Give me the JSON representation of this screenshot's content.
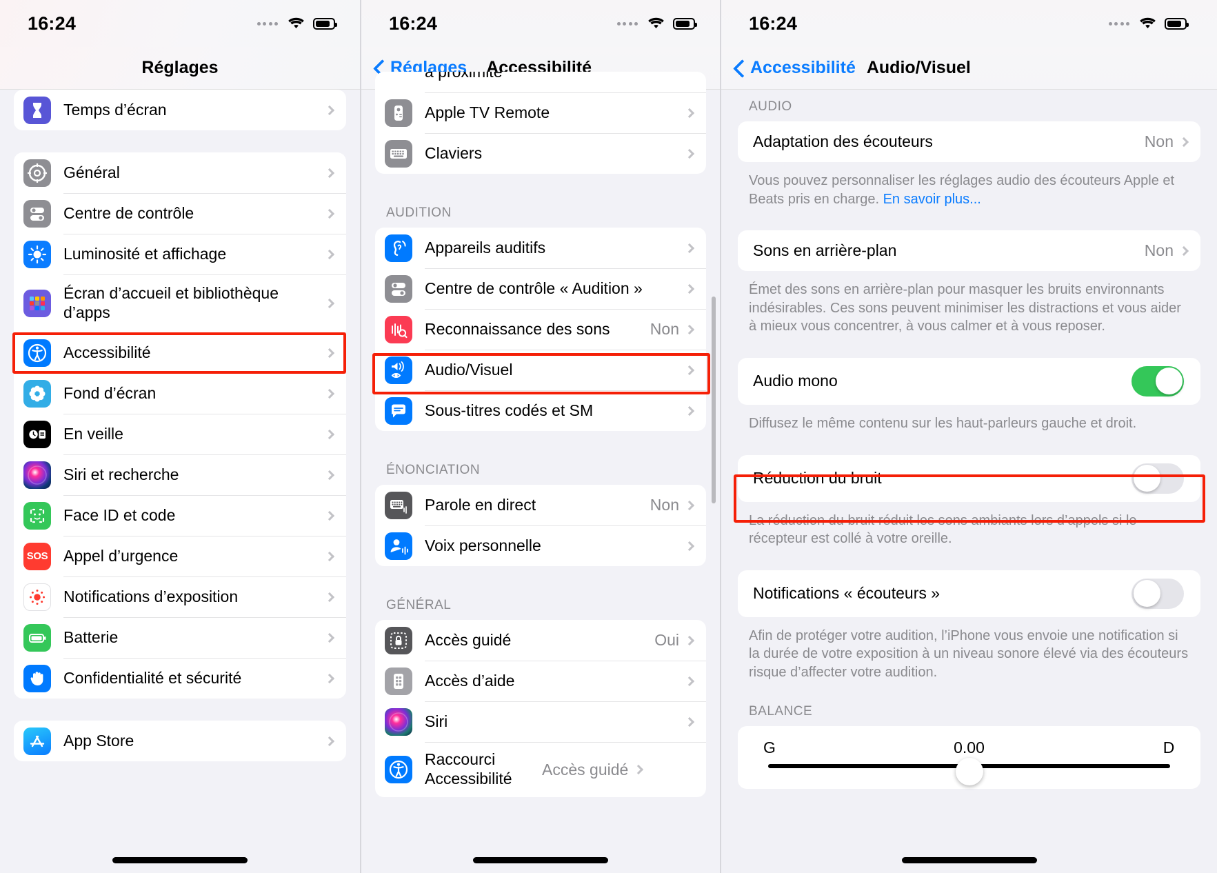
{
  "panels": [
    {
      "status": {
        "time": "16:24"
      },
      "nav": {
        "title": "Réglages"
      },
      "groups": [
        {
          "rows": [
            {
              "label": "Temps d’écran",
              "icon": "hourglass-icon",
              "chevron": true
            }
          ]
        },
        {
          "rows": [
            {
              "label": "Général",
              "icon": "gear-icon",
              "chevron": true
            },
            {
              "label": "Centre de contrôle",
              "icon": "control-center-icon",
              "chevron": true
            },
            {
              "label": "Luminosité et affichage",
              "icon": "brightness-icon",
              "chevron": true
            },
            {
              "label": "Écran d’accueil et bibliothèque d’apps",
              "icon": "home-screen-icon",
              "chevron": true
            },
            {
              "label": "Accessibilité",
              "icon": "accessibility-icon",
              "chevron": true,
              "highlight": true
            },
            {
              "label": "Fond d’écran",
              "icon": "wallpaper-icon",
              "chevron": true
            },
            {
              "label": "En veille",
              "icon": "standby-icon",
              "chevron": true
            },
            {
              "label": "Siri et recherche",
              "icon": "siri-icon",
              "chevron": true
            },
            {
              "label": "Face ID et code",
              "icon": "face-id-icon",
              "chevron": true
            },
            {
              "label": "Appel d’urgence",
              "icon": "sos-icon",
              "chevron": true
            },
            {
              "label": "Notifications d’exposition",
              "icon": "exposure-notification-icon",
              "chevron": true
            },
            {
              "label": "Batterie",
              "icon": "battery-icon",
              "chevron": true
            },
            {
              "label": "Confidentialité et sécurité",
              "icon": "privacy-hand-icon",
              "chevron": true
            }
          ]
        },
        {
          "rows": [
            {
              "label": "App Store",
              "icon": "app-store-icon",
              "chevron": true
            }
          ]
        }
      ]
    },
    {
      "status": {
        "time": "16:24"
      },
      "nav": {
        "back_label": "Réglages",
        "title": "Accessibilité"
      },
      "clipped_top_text": "à proximité",
      "groups": [
        {
          "rows": [
            {
              "label": "Apple TV Remote",
              "icon": "tv-remote-icon",
              "chevron": true
            },
            {
              "label": "Claviers",
              "icon": "keyboard-icon",
              "chevron": true
            }
          ]
        },
        {
          "header": "AUDITION",
          "rows": [
            {
              "label": "Appareils auditifs",
              "icon": "hearing-devices-icon",
              "chevron": true
            },
            {
              "label": "Centre de contrôle « Audition »",
              "icon": "control-center-icon",
              "chevron": true
            },
            {
              "label": "Reconnaissance des sons",
              "icon": "sound-recognition-icon",
              "value": "Non",
              "chevron": true
            },
            {
              "label": "Audio/Visuel",
              "icon": "audio-visual-icon",
              "chevron": true,
              "highlight": true
            },
            {
              "label": "Sous-titres codés et SM",
              "icon": "subtitles-icon",
              "chevron": true
            }
          ]
        },
        {
          "header": "ÉNONCIATION",
          "rows": [
            {
              "label": "Parole en direct",
              "icon": "live-speech-icon",
              "value": "Non",
              "chevron": true
            },
            {
              "label": "Voix personnelle",
              "icon": "personal-voice-icon",
              "chevron": true
            }
          ]
        },
        {
          "header": "GÉNÉRAL",
          "rows": [
            {
              "label": "Accès guidé",
              "icon": "guided-access-icon",
              "value": "Oui",
              "chevron": true
            },
            {
              "label": "Accès d’aide",
              "icon": "assistive-access-icon",
              "chevron": true
            },
            {
              "label": "Siri",
              "icon": "siri-icon",
              "chevron": true
            },
            {
              "label": "Raccourci Accessibilité",
              "icon": "accessibility-icon",
              "value": "Accès guidé",
              "chevron": true
            }
          ]
        }
      ]
    },
    {
      "status": {
        "time": "16:24"
      },
      "nav": {
        "back_label": "Accessibilité",
        "title": "Audio/Visuel"
      },
      "sections": [
        {
          "header": "AUDIO",
          "rows": [
            {
              "label": "Adaptation des écouteurs",
              "value": "Non",
              "chevron": true
            }
          ],
          "desc": "Vous pouvez personnaliser les réglages audio des écouteurs Apple et Beats pris en charge. ",
          "desc_link": "En savoir plus..."
        },
        {
          "rows": [
            {
              "label": "Sons en arrière-plan",
              "value": "Non",
              "chevron": true
            }
          ],
          "desc": "Émet des sons en arrière-plan pour masquer les bruits environnants indésirables. Ces sons peuvent minimiser les distractions et vous aider à mieux vous concentrer, à vous calmer et à vous reposer."
        },
        {
          "rows": [
            {
              "label": "Audio mono",
              "toggle": "on"
            }
          ],
          "desc": "Diffusez le même contenu sur les haut-parleurs gauche et droit."
        },
        {
          "rows": [
            {
              "label": "Réduction du bruit",
              "toggle": "off",
              "highlight": true
            }
          ],
          "desc": "La réduction du bruit réduit les sons ambiants lors d’appels si le récepteur est collé à votre oreille."
        },
        {
          "rows": [
            {
              "label": "Notifications « écouteurs »",
              "toggle": "off"
            }
          ],
          "desc": "Afin de protéger votre audition, l’iPhone vous envoie une notification si la durée de votre exposition à un niveau sonore élevé via des écouteurs risque d’affecter votre audition."
        },
        {
          "header": "BALANCE",
          "balance": {
            "left_label": "G",
            "right_label": "D",
            "value": "0.00"
          }
        }
      ]
    }
  ],
  "colors": {
    "highlight": "#f51f07",
    "accent_blue": "#0a7cff",
    "toggle_on": "#34c759"
  }
}
